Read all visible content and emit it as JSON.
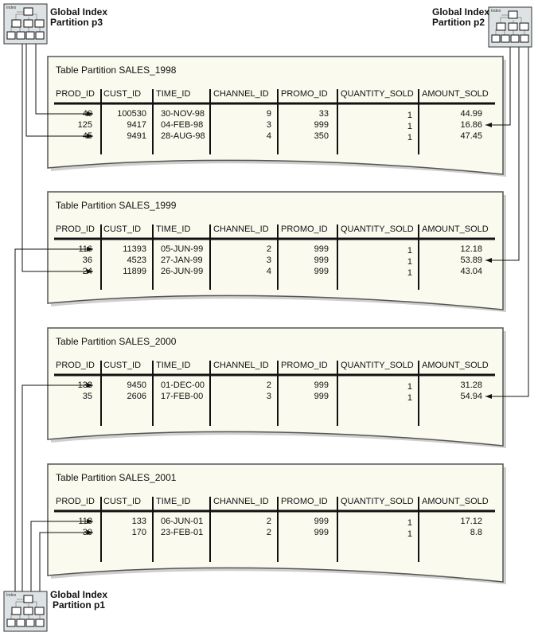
{
  "indexes": [
    {
      "id": "p3",
      "line1": "Global Index",
      "line2": "Partition p3",
      "icon": "index-tree-icon",
      "icon_label": "Index"
    },
    {
      "id": "p2",
      "line1": "Global Index",
      "line2": "Partition p2",
      "icon": "index-tree-icon",
      "icon_label": "Index"
    },
    {
      "id": "p1",
      "line1": "Global Index",
      "line2": "Partition p1",
      "icon": "index-tree-icon",
      "icon_label": "Index"
    }
  ],
  "columns": [
    "PROD_ID",
    "CUST_ID",
    "TIME_ID",
    "CHANNEL_ID",
    "PROMO_ID",
    "QUANTITY_SOLD",
    "AMOUNT_SOLD"
  ],
  "partitions": [
    {
      "title": "Table Partition SALES_1998",
      "rows": [
        [
          "40",
          "100530",
          "30-NOV-98",
          "9",
          "33",
          "1",
          "44.99"
        ],
        [
          "125",
          "9417",
          "04-FEB-98",
          "3",
          "999",
          "1",
          "16.86"
        ],
        [
          "45",
          "9491",
          "28-AUG-98",
          "4",
          "350",
          "1",
          "47.45"
        ]
      ]
    },
    {
      "title": "Table Partition SALES_1999",
      "rows": [
        [
          "116",
          "11393",
          "05-JUN-99",
          "2",
          "999",
          "1",
          "12.18"
        ],
        [
          "36",
          "4523",
          "27-JAN-99",
          "3",
          "999",
          "1",
          "53.89"
        ],
        [
          "24",
          "11899",
          "26-JUN-99",
          "4",
          "999",
          "1",
          "43.04"
        ]
      ]
    },
    {
      "title": "Table Partition SALES_2000",
      "rows": [
        [
          "133",
          "9450",
          "01-DEC-00",
          "2",
          "999",
          "1",
          "31.28"
        ],
        [
          "35",
          "2606",
          "17-FEB-00",
          "3",
          "999",
          "1",
          "54.94"
        ]
      ]
    },
    {
      "title": "Table Partition SALES_2001",
      "rows": [
        [
          "118",
          "133",
          "06-JUN-01",
          "2",
          "999",
          "1",
          "17.12"
        ],
        [
          "30",
          "170",
          "23-FEB-01",
          "2",
          "999",
          "1",
          "8.8"
        ]
      ]
    }
  ],
  "pointers": [
    {
      "from": "p3",
      "partition": 0,
      "row": 0,
      "column": "PROD_ID"
    },
    {
      "from": "p3",
      "partition": 0,
      "row": 2,
      "column": "PROD_ID"
    },
    {
      "from": "p3",
      "partition": 1,
      "row": 2,
      "column": "PROD_ID"
    },
    {
      "from": "p2",
      "partition": 0,
      "row": 1,
      "column": "AMOUNT_SOLD"
    },
    {
      "from": "p2",
      "partition": 1,
      "row": 1,
      "column": "AMOUNT_SOLD"
    },
    {
      "from": "p2",
      "partition": 2,
      "row": 1,
      "column": "AMOUNT_SOLD"
    },
    {
      "from": "p1",
      "partition": 1,
      "row": 0,
      "column": "PROD_ID"
    },
    {
      "from": "p1",
      "partition": 2,
      "row": 0,
      "column": "PROD_ID"
    },
    {
      "from": "p1",
      "partition": 3,
      "row": 0,
      "column": "PROD_ID"
    },
    {
      "from": "p1",
      "partition": 3,
      "row": 1,
      "column": "PROD_ID"
    }
  ],
  "colors": {
    "paper": "#fbfaee",
    "paper_border": "#555555",
    "shadow": "#cfcfcf",
    "index_box": "#dde2e4",
    "line": "#111111"
  }
}
